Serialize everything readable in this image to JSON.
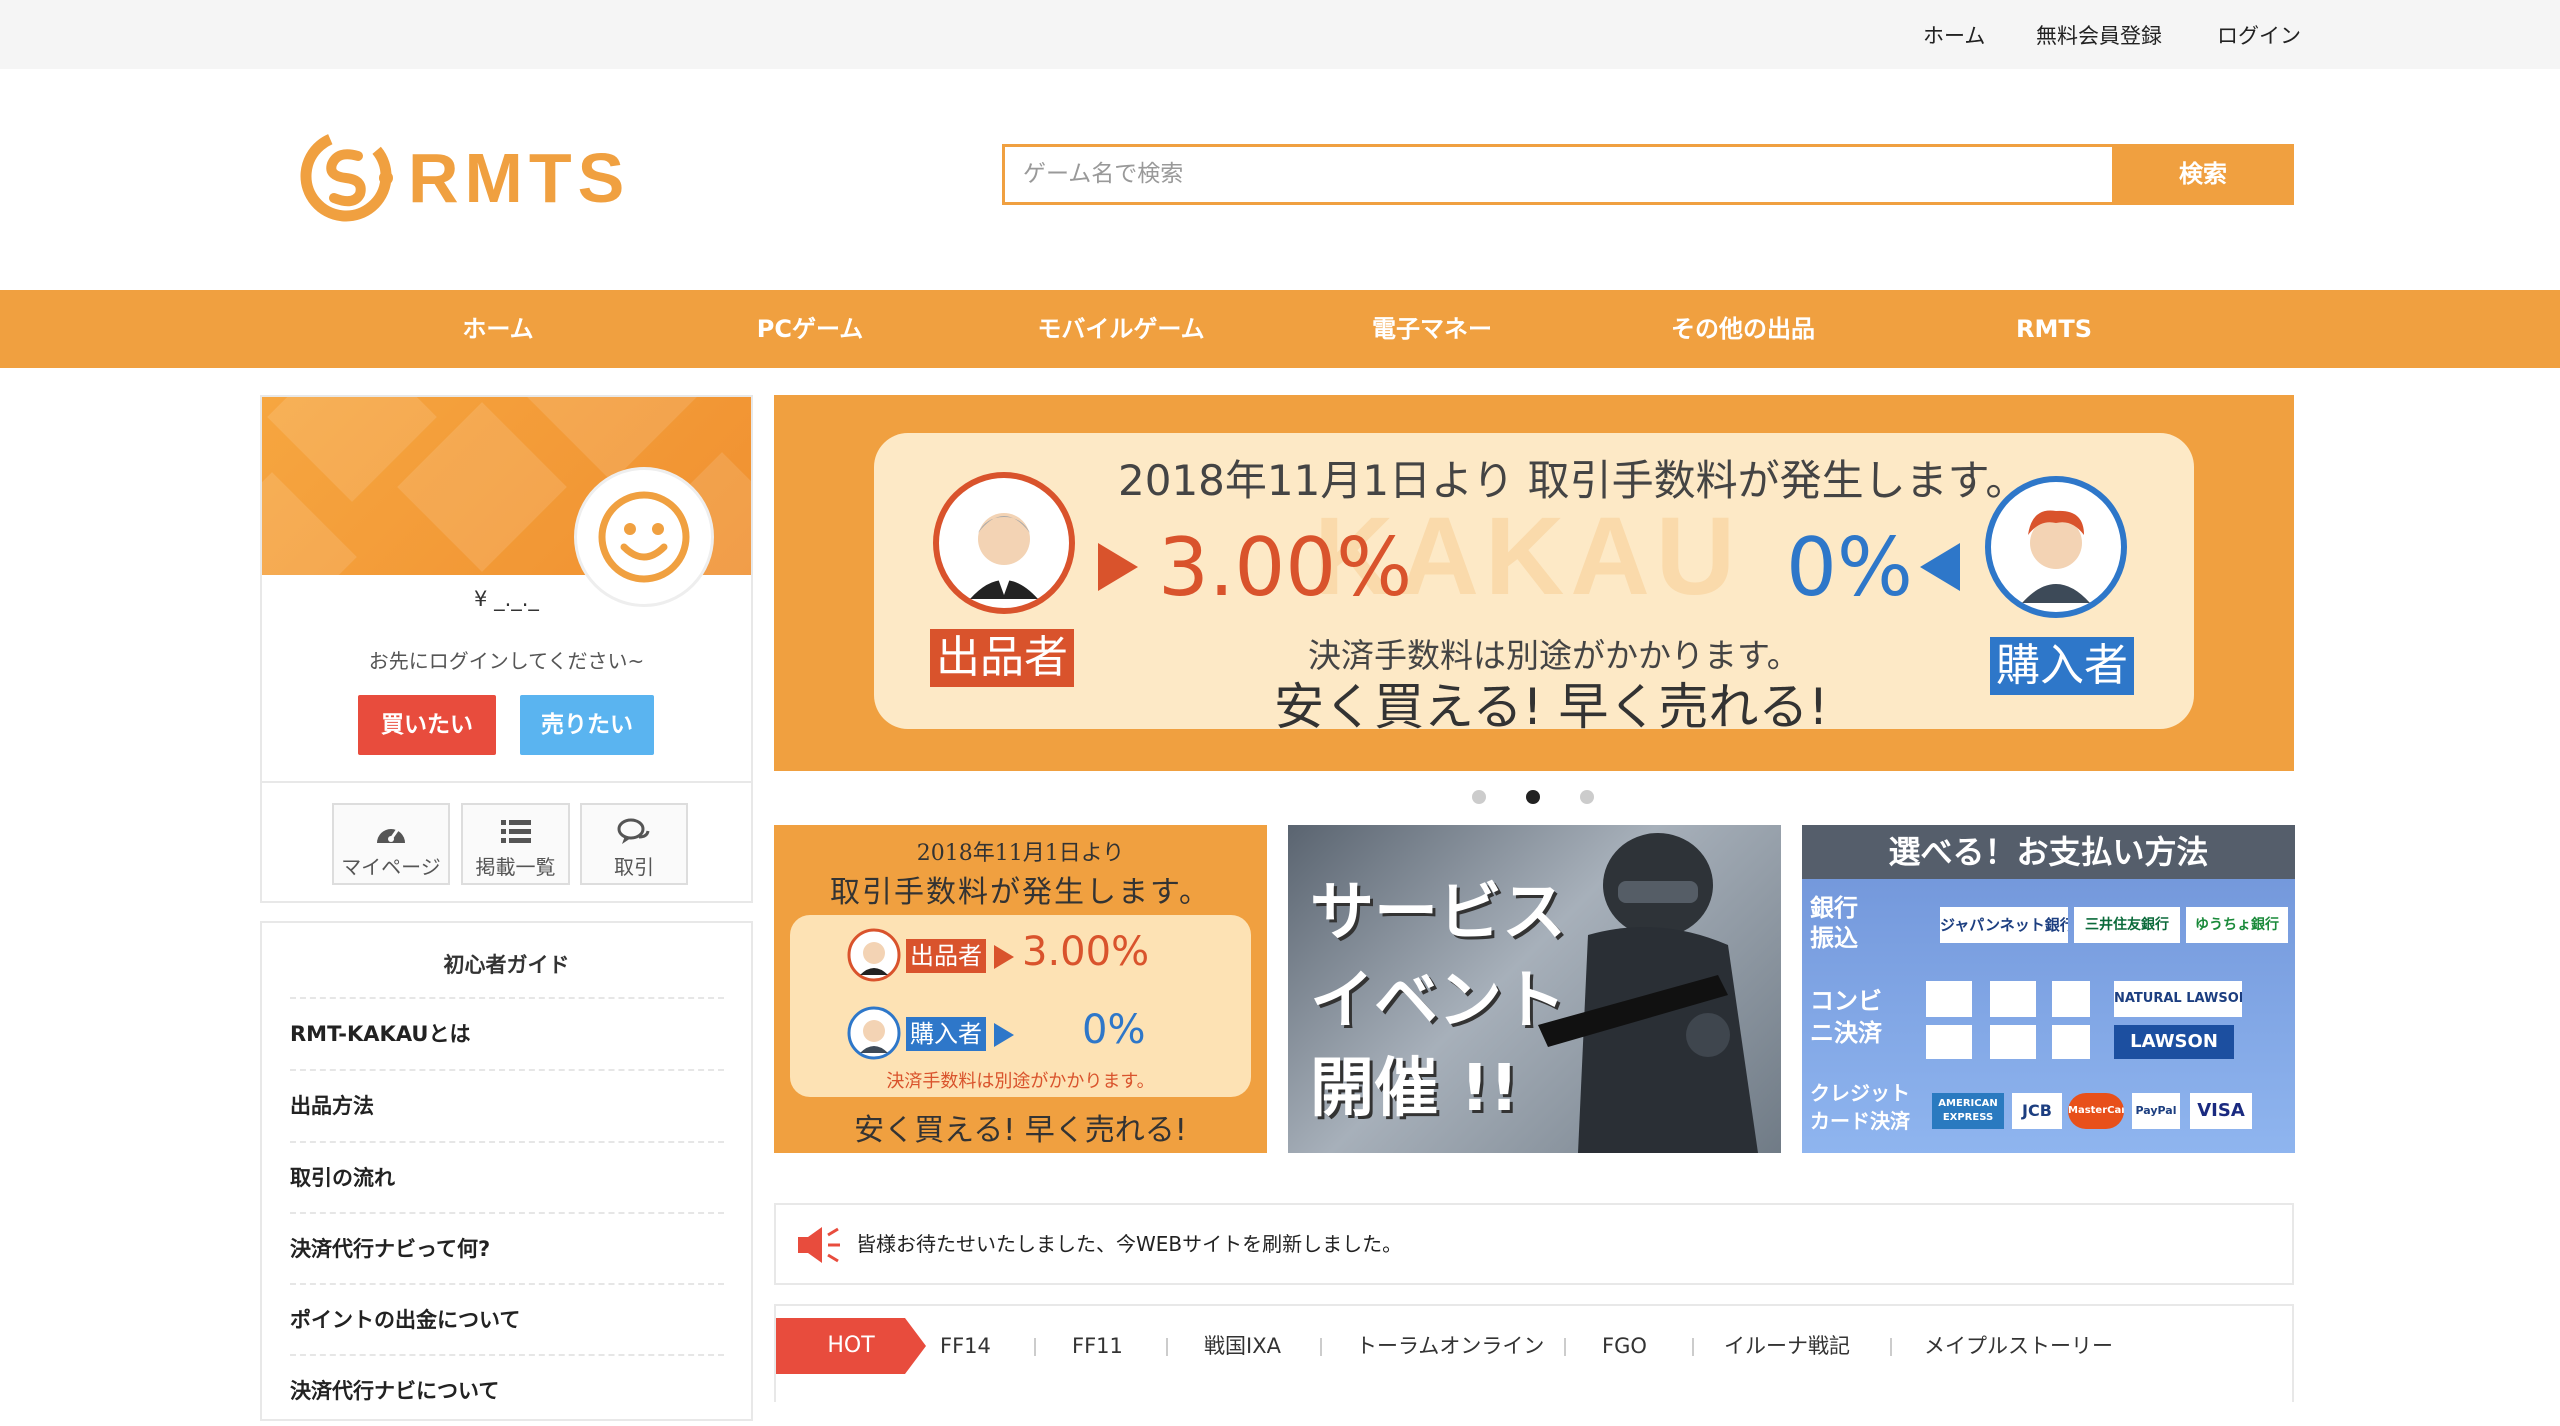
{
  "topbar": {
    "home": "ホーム",
    "register": "無料会員登録",
    "login": "ログイン"
  },
  "logo": {
    "text": "RMTS",
    "icon": "logo-s-icon",
    "color": "#f0a040"
  },
  "search": {
    "placeholder": "ゲーム名で検索",
    "button": "検索"
  },
  "nav": {
    "items": [
      "ホーム",
      "PCゲーム",
      "モバイルゲーム",
      "電子マネー",
      "その他の出品",
      "RMTS"
    ]
  },
  "profile": {
    "price": "¥ _._._",
    "login_message": "お先にログインしてください~",
    "buy_button": "買いたい",
    "sell_button": "売りたい",
    "quick_links": [
      {
        "label": "マイページ",
        "icon": "dashboard-icon"
      },
      {
        "label": "掲載一覧",
        "icon": "list-icon"
      },
      {
        "label": "取引",
        "icon": "chat-icon"
      }
    ]
  },
  "guide": {
    "title": "初心者ガイド",
    "items": [
      "RMT-KAKAUとは",
      "出品方法",
      "取引の流れ",
      "決済代行ナビって何?",
      "ポイントの出金について",
      "決済代行ナビについて"
    ]
  },
  "slider": {
    "headline": "2018年11月1日より 取引手数料が発生します。",
    "seller_rate": "3.00%",
    "buyer_rate": "0%",
    "seller_label": "出品者",
    "buyer_label": "購入者",
    "note": "決済手数料は別途がかかります。",
    "tagline": "安く買える! 早く売れる!",
    "watermark": "KAKAU",
    "active_dot": 1
  },
  "banners": {
    "b1": {
      "line1": "2018年11月1日より",
      "line2": "取引手数料が発生します。",
      "seller": "出品者",
      "seller_rate": "3.00%",
      "buyer": "購入者",
      "buyer_rate": "0%",
      "note": "決済手数料は別途がかかります。",
      "tagline": "安く買える! 早く売れる!"
    },
    "b2": {
      "text": "サービスイベント開催 !!"
    },
    "b3": {
      "title": "選べる！お支払い方法",
      "rows": [
        {
          "label": "銀行振込",
          "logos": [
            "ジャパンネット銀行",
            "三井住友銀行",
            "ゆうちょ銀行"
          ]
        },
        {
          "label": "コンビニ決済",
          "logos": [
            "NATURAL LAWSON",
            "LAWSON"
          ]
        },
        {
          "label": "クレジットカード決済",
          "logos": [
            "AMERICAN EXPRESS",
            "JCB",
            "MasterCard",
            "PayPal",
            "VISA"
          ]
        }
      ]
    }
  },
  "notice": {
    "text": "皆様お待たせいたしました、今WEBサイトを刷新しました。",
    "icon": "megaphone-icon"
  },
  "tags": {
    "hot": "HOT",
    "items": [
      "FF14",
      "FF11",
      "戦国IXA",
      "トーラムオンライン",
      "FGO",
      "イルーナ戦記",
      "メイプルストーリー"
    ]
  }
}
